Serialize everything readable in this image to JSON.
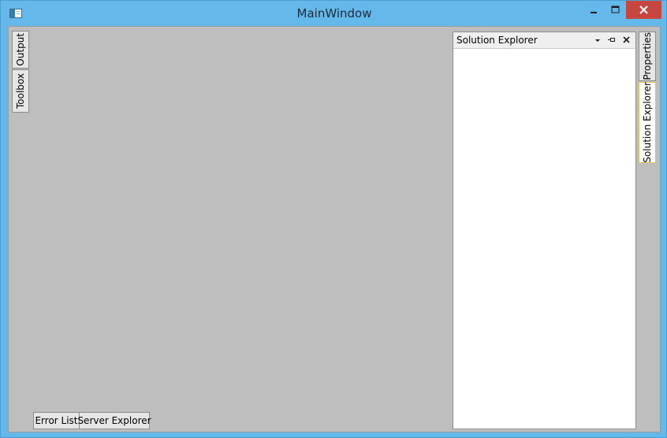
{
  "window": {
    "title": "MainWindow",
    "icon": "window-app-icon",
    "caption_buttons": [
      "minimize-icon",
      "maximize-icon",
      "close-icon"
    ],
    "accent_color": "#65b9ea",
    "close_color": "#c7463f"
  },
  "left_tabs": [
    {
      "label": "Output",
      "icon": null
    },
    {
      "label": "Toolbox",
      "icon": null
    }
  ],
  "right_tabs": [
    {
      "label": "Properties",
      "active": false
    },
    {
      "label": "Solution Explorer",
      "active": true
    }
  ],
  "bottom_tabs": [
    {
      "label": "Error List"
    },
    {
      "label": "Server Explorer"
    }
  ],
  "panel": {
    "title": "Solution Explorer",
    "header_icons": [
      "dropdown-icon",
      "pin-icon",
      "close-icon"
    ]
  },
  "colors": {
    "dock_background": "#bebebe",
    "active_tab_border": "#e0c15a"
  }
}
